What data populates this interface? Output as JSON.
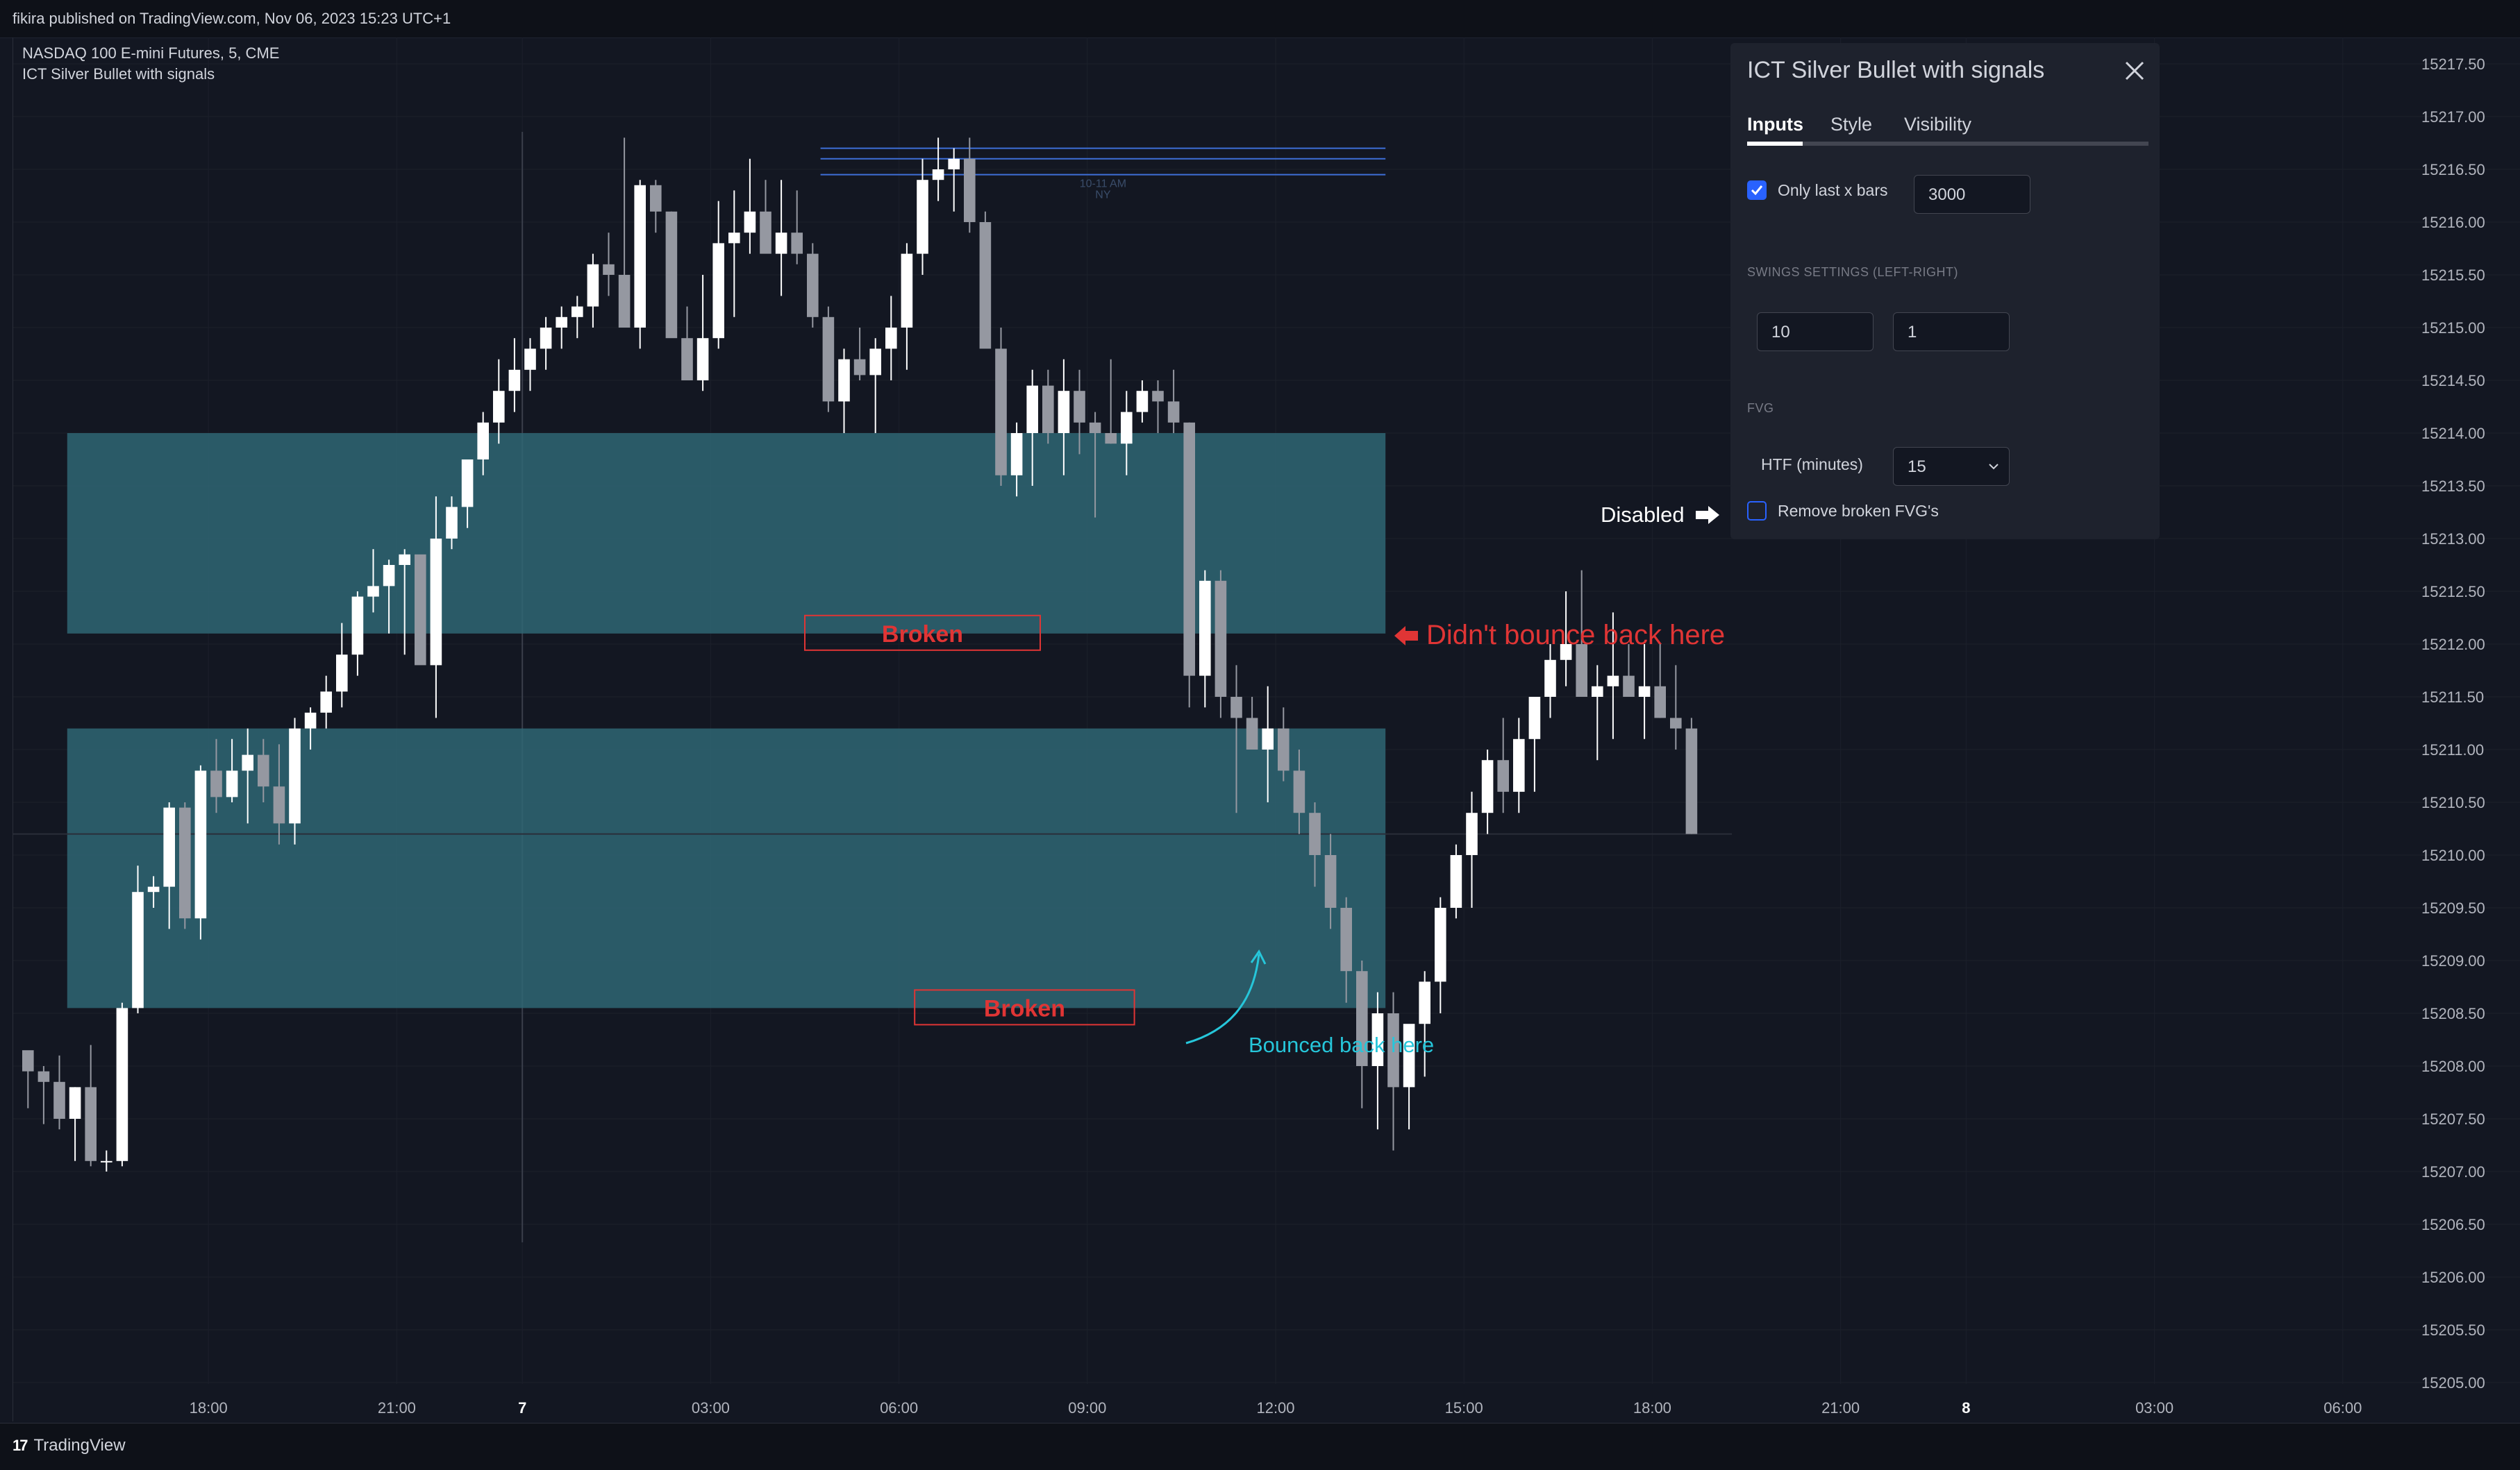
{
  "header": {
    "publish_line": "fikira published on TradingView.com, Nov 06, 2023 15:23 UTC+1"
  },
  "legend": {
    "symbol": "NASDAQ 100 E-mini Futures, 5, CME",
    "indicator": "ICT Silver Bullet with signals"
  },
  "footer": {
    "brand": "TradingView",
    "logo": "17"
  },
  "colors": {
    "bg": "#131722",
    "up": "#ffffff",
    "down": "#9598a1",
    "fvg": "#2f6673",
    "broken": "#e03535",
    "bounce": "#26c6da",
    "session_line": "#3e6fd8"
  },
  "chart_data": {
    "type": "candlestick",
    "symbol": "NASDAQ 100 E-mini Futures",
    "timeframe": "5",
    "exchange": "CME",
    "y_ticks": [
      "15217.50",
      "15217.00",
      "15216.50",
      "15216.00",
      "15215.50",
      "15215.00",
      "15214.50",
      "15214.00",
      "15213.50",
      "15213.00",
      "15212.50",
      "15212.00",
      "15211.50",
      "15211.00",
      "15210.50",
      "15210.00",
      "15209.50",
      "15209.00",
      "15208.50",
      "15208.00",
      "15207.50",
      "15207.00",
      "15206.50",
      "15206.00",
      "15205.50",
      "15205.00"
    ],
    "ylim": [
      15205.0,
      15217.5
    ],
    "x_ticks": [
      {
        "label": "18:00",
        "bar": 12,
        "bold": false
      },
      {
        "label": "21:00",
        "bar": 24,
        "bold": false
      },
      {
        "label": "7",
        "bar": 32,
        "bold": true
      },
      {
        "label": "03:00",
        "bar": 44,
        "bold": false
      },
      {
        "label": "06:00",
        "bar": 56,
        "bold": false
      },
      {
        "label": "09:00",
        "bar": 68,
        "bold": false
      },
      {
        "label": "12:00",
        "bar": 80,
        "bold": false
      },
      {
        "label": "15:00",
        "bar": 92,
        "bold": false
      },
      {
        "label": "18:00",
        "bar": 104,
        "bold": false
      },
      {
        "label": "21:00",
        "bar": 116,
        "bold": false
      },
      {
        "label": "8",
        "bar": 124,
        "bold": true
      },
      {
        "label": "03:00",
        "bar": 136,
        "bold": false
      },
      {
        "label": "06:00",
        "bar": 148,
        "bold": false
      }
    ],
    "candles": [
      [
        15208.15,
        15208.1,
        15207.6,
        15207.95
      ],
      [
        15207.95,
        15208.0,
        15207.45,
        15207.85
      ],
      [
        15207.85,
        15208.1,
        15207.4,
        15207.5
      ],
      [
        15207.5,
        15207.8,
        15207.1,
        15207.8
      ],
      [
        15207.8,
        15208.2,
        15207.05,
        15207.1
      ],
      [
        15207.1,
        15207.2,
        15207.0,
        15207.1
      ],
      [
        15207.1,
        15208.6,
        15207.05,
        15208.55
      ],
      [
        15208.55,
        15209.9,
        15208.5,
        15209.65
      ],
      [
        15209.65,
        15209.8,
        15209.5,
        15209.7
      ],
      [
        15209.7,
        15210.5,
        15209.3,
        15210.45
      ],
      [
        15210.45,
        15210.5,
        15209.3,
        15209.4
      ],
      [
        15209.4,
        15210.85,
        15209.2,
        15210.8
      ],
      [
        15210.8,
        15211.1,
        15210.4,
        15210.55
      ],
      [
        15210.55,
        15211.1,
        15210.5,
        15210.8
      ],
      [
        15210.8,
        15211.2,
        15210.3,
        15210.95
      ],
      [
        15210.95,
        15211.1,
        15210.5,
        15210.65
      ],
      [
        15210.65,
        15211.05,
        15210.1,
        15210.3
      ],
      [
        15210.3,
        15211.3,
        15210.1,
        15211.2
      ],
      [
        15211.2,
        15211.4,
        15211.0,
        15211.35
      ],
      [
        15211.35,
        15211.7,
        15211.2,
        15211.55
      ],
      [
        15211.55,
        15212.2,
        15211.4,
        15211.9
      ],
      [
        15211.9,
        15212.5,
        15211.7,
        15212.45
      ],
      [
        15212.45,
        15212.9,
        15212.3,
        15212.55
      ],
      [
        15212.55,
        15212.8,
        15212.1,
        15212.75
      ],
      [
        15212.75,
        15212.9,
        15211.9,
        15212.85
      ],
      [
        15212.85,
        15212.6,
        15212.3,
        15211.8
      ],
      [
        15211.8,
        15213.4,
        15211.3,
        15213.0
      ],
      [
        15213.0,
        15213.4,
        15212.9,
        15213.3
      ],
      [
        15213.3,
        15213.7,
        15213.1,
        15213.75
      ],
      [
        15213.75,
        15214.2,
        15213.6,
        15214.1
      ],
      [
        15214.1,
        15214.7,
        15213.9,
        15214.4
      ],
      [
        15214.4,
        15214.9,
        15214.2,
        15214.6
      ],
      [
        15214.6,
        15214.9,
        15214.4,
        15214.8
      ],
      [
        15214.8,
        15215.1,
        15214.6,
        15215.0
      ],
      [
        15215.0,
        15215.2,
        15214.8,
        15215.1
      ],
      [
        15215.1,
        15215.3,
        15214.9,
        15215.2
      ],
      [
        15215.2,
        15215.7,
        15215.0,
        15215.6
      ],
      [
        15215.6,
        15215.9,
        15215.3,
        15215.5
      ],
      [
        15215.5,
        15216.8,
        15215.0,
        15215.0
      ],
      [
        15215.0,
        15216.4,
        15214.8,
        15216.35
      ],
      [
        15216.35,
        15216.4,
        15215.9,
        15216.1
      ],
      [
        15216.1,
        15216.1,
        15215.4,
        15214.9
      ],
      [
        15214.9,
        15215.2,
        15214.5,
        15214.5
      ],
      [
        15214.5,
        15215.5,
        15214.4,
        15214.9
      ],
      [
        15214.9,
        15216.2,
        15214.8,
        15215.8
      ],
      [
        15215.8,
        15216.3,
        15215.1,
        15215.9
      ],
      [
        15215.9,
        15216.6,
        15215.7,
        15216.1
      ],
      [
        15216.1,
        15216.4,
        15215.8,
        15215.7
      ],
      [
        15215.7,
        15216.4,
        15215.3,
        15215.9
      ],
      [
        15215.9,
        15216.3,
        15215.6,
        15215.7
      ],
      [
        15215.7,
        15215.8,
        15215.0,
        15215.1
      ],
      [
        15215.1,
        15215.2,
        15214.2,
        15214.3
      ],
      [
        15214.3,
        15214.8,
        15214.0,
        15214.7
      ],
      [
        15214.7,
        15215.0,
        15214.5,
        15214.55
      ],
      [
        15214.55,
        15214.9,
        15214.0,
        15214.8
      ],
      [
        15214.8,
        15215.3,
        15214.5,
        15215.0
      ],
      [
        15215.0,
        15215.8,
        15214.6,
        15215.7
      ],
      [
        15215.7,
        15216.6,
        15215.5,
        15216.4
      ],
      [
        15216.4,
        15216.8,
        15216.2,
        15216.5
      ],
      [
        15216.5,
        15216.7,
        15216.1,
        15216.6
      ],
      [
        15216.6,
        15216.8,
        15215.9,
        15216.0
      ],
      [
        15216.0,
        15216.1,
        15214.9,
        15214.8
      ],
      [
        15214.8,
        15215.0,
        15213.5,
        15213.6
      ],
      [
        15213.6,
        15214.1,
        15213.4,
        15214.0
      ],
      [
        15214.0,
        15214.6,
        15213.5,
        15214.45
      ],
      [
        15214.45,
        15214.6,
        15213.9,
        15214.0
      ],
      [
        15214.0,
        15214.7,
        15213.6,
        15214.4
      ],
      [
        15214.4,
        15214.6,
        15213.8,
        15214.1
      ],
      [
        15214.1,
        15214.2,
        15213.2,
        15214.0
      ],
      [
        15214.0,
        15214.7,
        15213.9,
        15213.9
      ],
      [
        15213.9,
        15214.4,
        15213.6,
        15214.2
      ],
      [
        15214.2,
        15214.5,
        15214.1,
        15214.4
      ],
      [
        15214.4,
        15214.5,
        15214.0,
        15214.3
      ],
      [
        15214.3,
        15214.6,
        15214.0,
        15214.1
      ],
      [
        15214.1,
        15214.1,
        15211.4,
        15211.7
      ],
      [
        15211.7,
        15212.7,
        15211.4,
        15212.6
      ],
      [
        15212.6,
        15212.7,
        15211.3,
        15211.5
      ],
      [
        15211.5,
        15211.8,
        15210.4,
        15211.3
      ],
      [
        15211.3,
        15211.5,
        15211.0,
        15211.0
      ],
      [
        15211.0,
        15211.6,
        15210.5,
        15211.2
      ],
      [
        15211.2,
        15211.4,
        15210.7,
        15210.8
      ],
      [
        15210.8,
        15211.0,
        15210.2,
        15210.4
      ],
      [
        15210.4,
        15210.5,
        15209.7,
        15210.0
      ],
      [
        15210.0,
        15210.2,
        15209.3,
        15209.5
      ],
      [
        15209.5,
        15209.6,
        15208.6,
        15208.9
      ],
      [
        15208.9,
        15209.0,
        15207.6,
        15208.0
      ],
      [
        15208.0,
        15208.7,
        15207.4,
        15208.5
      ],
      [
        15208.5,
        15208.7,
        15207.2,
        15207.8
      ],
      [
        15207.8,
        15208.2,
        15207.4,
        15208.4
      ],
      [
        15208.4,
        15208.9,
        15207.9,
        15208.8
      ],
      [
        15208.8,
        15209.6,
        15208.5,
        15209.5
      ],
      [
        15209.5,
        15210.1,
        15209.4,
        15210.0
      ],
      [
        15210.0,
        15210.6,
        15209.5,
        15210.4
      ],
      [
        15210.4,
        15211.0,
        15210.2,
        15210.9
      ],
      [
        15210.9,
        15211.3,
        15210.4,
        15210.6
      ],
      [
        15210.6,
        15211.3,
        15210.4,
        15211.1
      ],
      [
        15211.1,
        15211.5,
        15210.6,
        15211.5
      ],
      [
        15211.5,
        15212.0,
        15211.3,
        15211.85
      ],
      [
        15211.85,
        15212.5,
        15211.6,
        15212.0
      ],
      [
        15212.0,
        15212.7,
        15211.5,
        15211.5
      ],
      [
        15211.5,
        15211.8,
        15210.9,
        15211.6
      ],
      [
        15211.6,
        15212.3,
        15211.1,
        15211.7
      ],
      [
        15211.7,
        15212.0,
        15211.5,
        15211.5
      ],
      [
        15211.5,
        15212.0,
        15211.1,
        15211.6
      ],
      [
        15211.6,
        15212.0,
        15211.3,
        15211.3
      ],
      [
        15211.3,
        15211.8,
        15211.0,
        15211.2
      ],
      [
        15211.2,
        15211.3,
        15210.2,
        15210.2
      ]
    ],
    "fvg_zones": [
      {
        "from_bar": 3,
        "to_bar": 87,
        "top": 15214.0,
        "bottom": 15212.1
      },
      {
        "from_bar": 3,
        "to_bar": 87,
        "top": 15211.2,
        "bottom": 15208.55
      }
    ],
    "session_box": {
      "label": "10-11 AM",
      "sublabel": "NY",
      "from_bar": 51,
      "to_bar": 87,
      "lines": [
        15216.7,
        15216.6,
        15216.45
      ]
    },
    "broken_labels": [
      {
        "text": "Broken",
        "from_bar": 50,
        "to_bar": 65,
        "price": 15212.1
      },
      {
        "text": "Broken",
        "from_bar": 57,
        "to_bar": 71,
        "price": 15208.55
      }
    ],
    "last_price": 15210.2,
    "last_bar": 107
  },
  "annotations": {
    "disabled": "Disabled",
    "no_bounce": "Didn't bounce back here",
    "bounced": "Bounced back here"
  },
  "settings": {
    "title": "ICT Silver Bullet with signals",
    "tabs": [
      "Inputs",
      "Style",
      "Visibility"
    ],
    "only_last_label": "Only last x bars",
    "only_last_value": "3000",
    "swings_label": "SWINGS SETTINGS (LEFT-RIGHT)",
    "swing_left": "10",
    "swing_right": "1",
    "fvg_label": "FVG",
    "htf_label": "HTF (minutes)",
    "htf_value": "15",
    "remove_label": "Remove broken FVG's"
  }
}
